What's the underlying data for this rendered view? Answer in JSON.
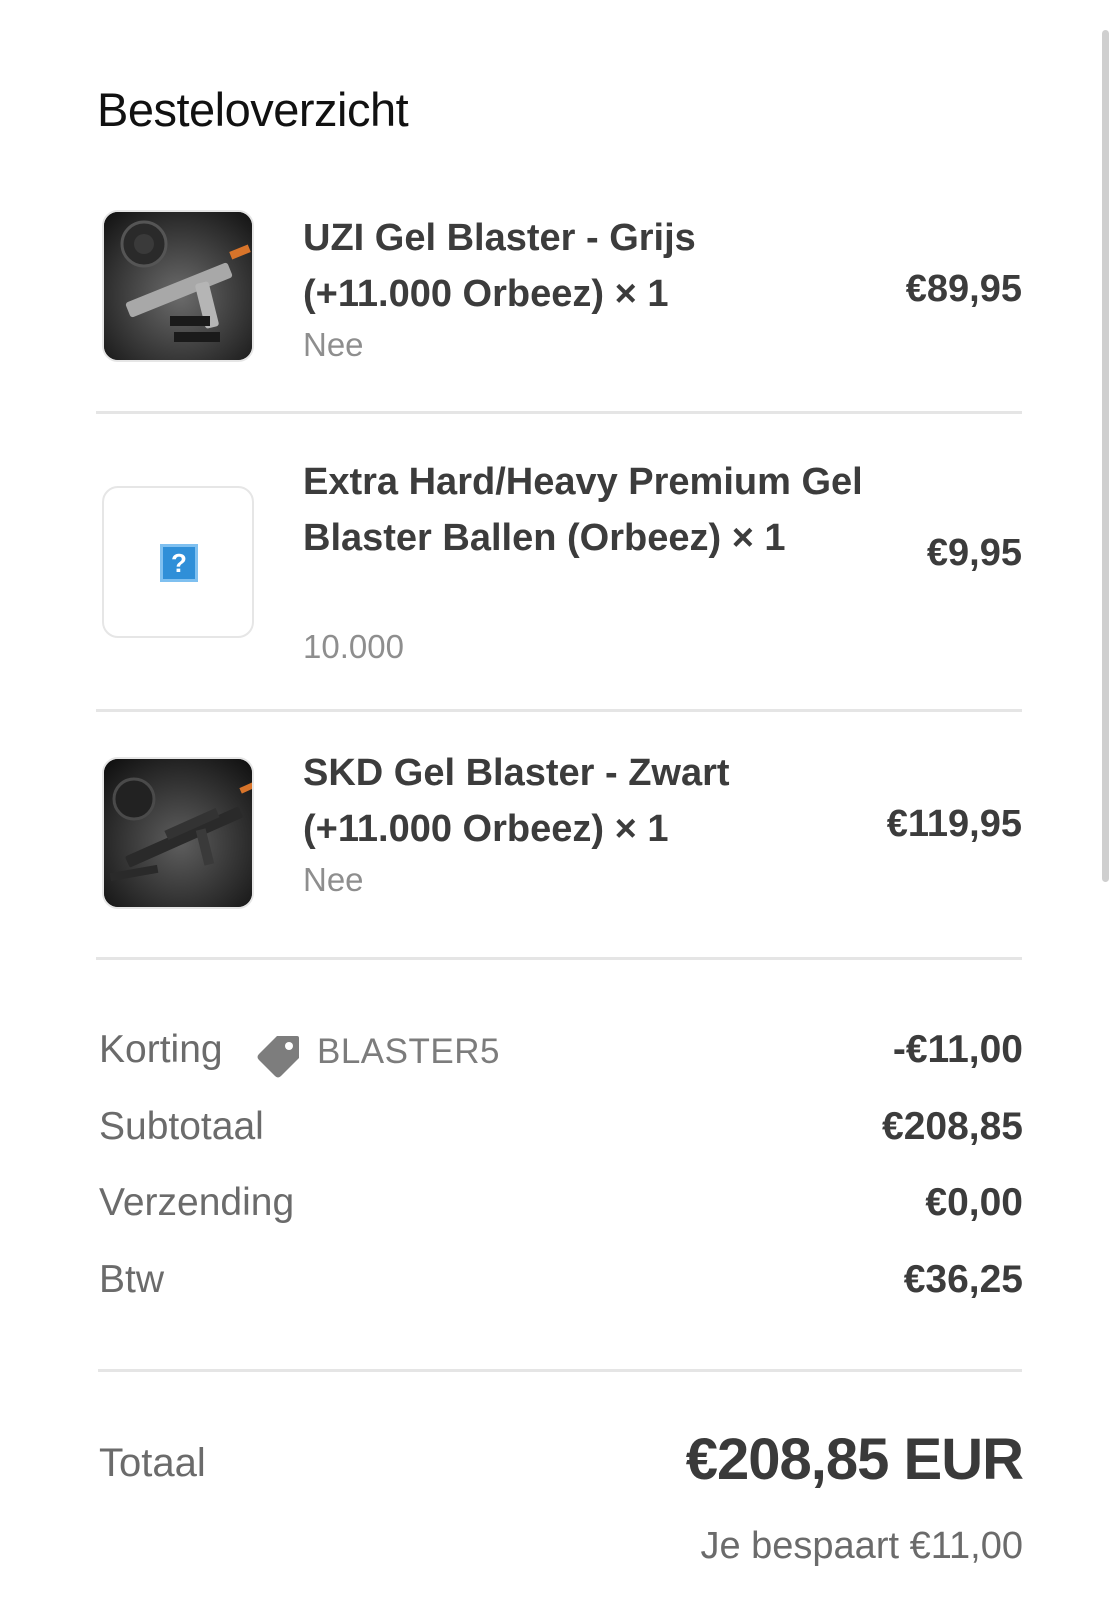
{
  "summary_title": "Besteloverzicht",
  "items": [
    {
      "name": "UZI Gel Blaster - Grijs (+11.000 Orbeez) × 1",
      "variant": "Nee",
      "price": "€89,95"
    },
    {
      "name": "Extra Hard/Heavy Premium Gel Blaster Ballen (Orbeez) × 1",
      "variant": "10.000",
      "price": "€9,95"
    },
    {
      "name": "SKD Gel Blaster - Zwart (+11.000 Orbeez) × 1",
      "variant": "Nee",
      "price": "€119,95"
    }
  ],
  "discount": {
    "label": "Korting",
    "code": "BLASTER5",
    "value": "-€11,00",
    "icon": "tag-icon"
  },
  "subtotal": {
    "label": "Subtotaal",
    "value": "€208,85"
  },
  "shipping": {
    "label": "Verzending",
    "value": "€0,00"
  },
  "tax": {
    "label": "Btw",
    "value": "€36,25"
  },
  "total": {
    "label": "Totaal",
    "value": "€208,85 EUR"
  },
  "savings": {
    "text": "Je bespaart €11,00"
  }
}
